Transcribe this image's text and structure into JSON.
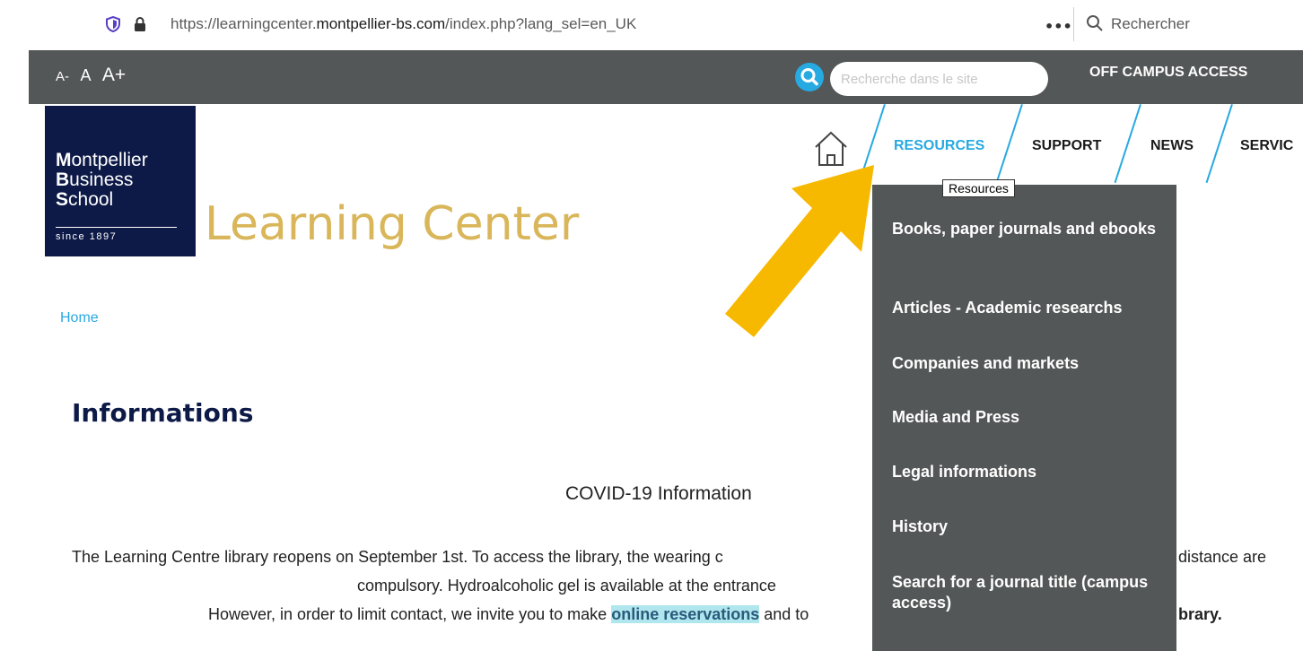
{
  "browser": {
    "url_prefix": "https://learningcenter.",
    "url_domain": "montpellier-bs.com",
    "url_suffix": "/index.php?lang_sel=en_UK",
    "more_icon": "•••",
    "search_placeholder": "Rechercher"
  },
  "topbar": {
    "font_minus": "A-",
    "font_normal": "A",
    "font_plus": "A+",
    "search_placeholder": "Recherche dans le site",
    "off_campus": "OFF CAMPUS ACCESS"
  },
  "logo": {
    "line1_initial": "M",
    "line1_rest": "ontpellier",
    "line2_initial": "B",
    "line2_rest": "usiness",
    "line3_initial": "S",
    "line3_rest": "chool",
    "since": "since 1897"
  },
  "site_title": "Learning Center",
  "nav": {
    "items": [
      "RESOURCES",
      "SUPPORT",
      "NEWS",
      "SERVIC"
    ]
  },
  "tooltip": "Resources",
  "dropdown": {
    "items": [
      "Books, paper journals and ebooks",
      "Articles - Academic researchs",
      "Companies and markets",
      "Media and Press",
      "Legal informations",
      "History",
      "Search for a journal title (campus access)"
    ]
  },
  "breadcrumb": "Home",
  "page_title": "Informations",
  "content": {
    "covid_title": "COVID-19 Information",
    "line1_a": "The Learning Centre library reopens on September 1st. To access the library, the wearing c",
    "line1_b": "distance are",
    "line2": "compulsory. Hydroalcoholic gel is available at the entrance",
    "line3_a": "However, in order to limit contact, we invite you to make ",
    "line3_link": "online reservations",
    "line3_b": " and to",
    "line3_c": "brary."
  },
  "colors": {
    "accent": "#27a9e1",
    "bar": "#545757",
    "navy": "#0d1a47",
    "gold": "#d9b65a",
    "arrow": "#f7b800"
  }
}
